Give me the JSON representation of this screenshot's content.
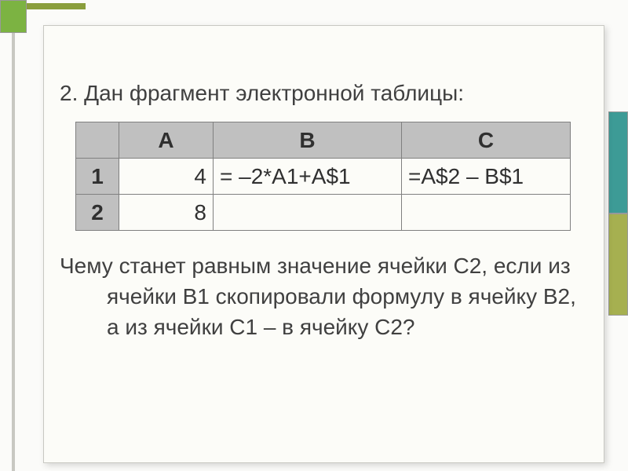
{
  "problem": {
    "intro": "2. Дан фрагмент электронной таблицы:",
    "question": "Чему станет равным значение ячейки С2, если из ячейки В1 скопировали формулу в ячейку В2, а из ячейки С1 – в ячейку С2?"
  },
  "table": {
    "headers": {
      "corner": "",
      "a": "A",
      "b": "B",
      "c": "C"
    },
    "rows": [
      {
        "num": "1",
        "a": "4",
        "b": "= –2*A1+A$1",
        "c": "=A$2 – B$1"
      },
      {
        "num": "2",
        "a": "8",
        "b": "",
        "c": ""
      }
    ]
  },
  "chart_data": {
    "type": "table",
    "description": "Spreadsheet fragment for formula copying problem",
    "columns": [
      "",
      "A",
      "B",
      "C"
    ],
    "rows": [
      [
        "1",
        "4",
        "= –2*A1+A$1",
        "=A$2 – B$1"
      ],
      [
        "2",
        "8",
        "",
        ""
      ]
    ]
  }
}
